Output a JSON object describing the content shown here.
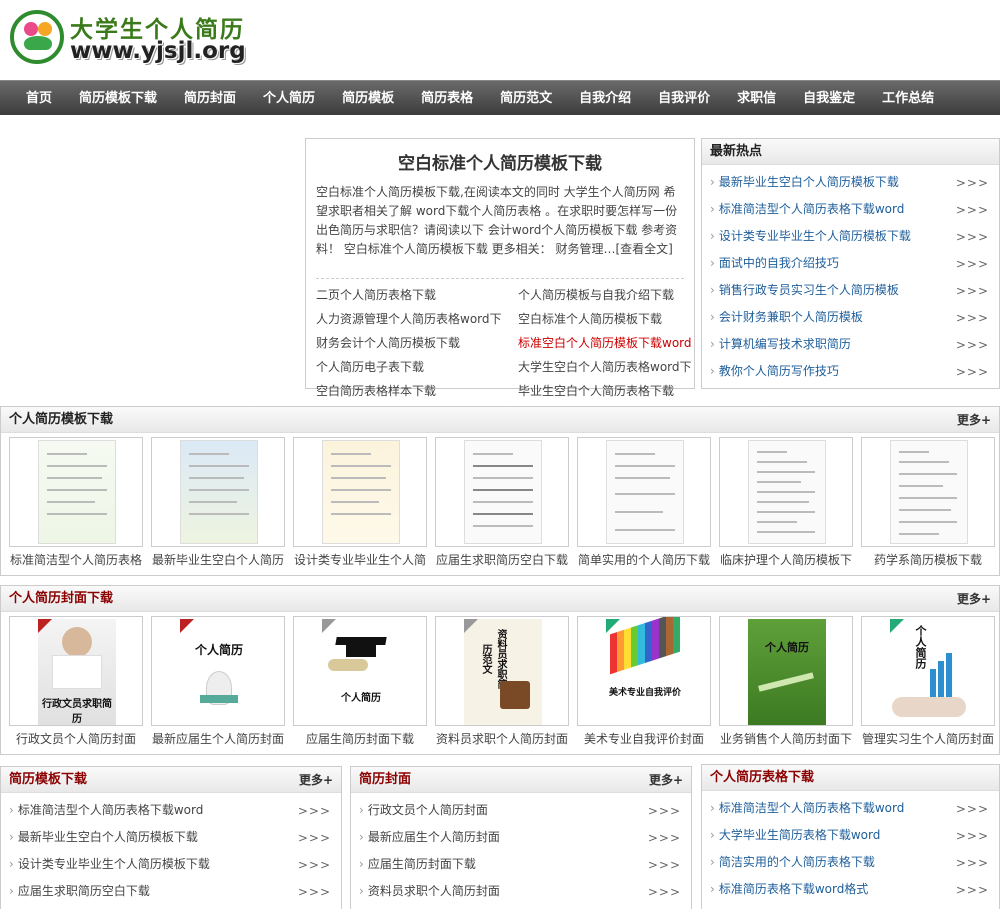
{
  "site": {
    "title": "大学生个人简历",
    "url": "www.yjsjl.org"
  },
  "nav": [
    "首页",
    "简历模板下载",
    "简历封面",
    "个人简历",
    "简历模板",
    "简历表格",
    "简历范文",
    "自我介绍",
    "自我评价",
    "求职信",
    "自我鉴定",
    "工作总结"
  ],
  "feature": {
    "title": "空白标准个人简历模板下载",
    "summary": "空白标准个人简历模板下载,在阅读本文的同时 大学生个人简历网 希望求职者相关了解 word下载个人简历表格 。在求职时要怎样写一份出色简历与求职信？请阅读以下 会计word个人简历模板下载 参考资料！ 空白标准个人简历模板下载 更多相关： 财务管理…[查看全文]",
    "links": [
      "二页个人简历表格下载",
      "个人简历模板与自我介绍下载",
      "人力资源管理个人简历表格word下",
      "空白标准个人简历模板下载",
      "财务会计个人简历模板下载",
      "标准空白个人简历模板下载word",
      "个人简历电子表下载",
      "大学生空白个人简历表格word下",
      "空白简历表格样本下载",
      "毕业生空白个人简历表格下载"
    ]
  },
  "hot": {
    "title": "最新热点",
    "arrow": ">>>",
    "items": [
      "最新毕业生空白个人简历模板下载",
      "标准简洁型个人简历表格下载word",
      "设计类专业毕业生个人简历模板下载",
      "面试中的自我介绍技巧",
      "销售行政专员实习生个人简历模板",
      "会计财务兼职个人简历模板",
      "计算机编写技术求职简历",
      "教你个人简历写作技巧"
    ]
  },
  "section_templates": {
    "title": "个人简历模板下载",
    "more": "更多+",
    "items": [
      "标准简洁型个人简历表格",
      "最新毕业生空白个人简历",
      "设计类专业毕业生个人简",
      "应届生求职简历空白下载",
      "简单实用的个人简历下载",
      "临床护理个人简历模板下",
      "药学系简历模板下载"
    ]
  },
  "section_covers": {
    "title": "个人简历封面下载",
    "more": "更多+",
    "items": [
      "行政文员个人简历封面",
      "最新应届生个人简历封面",
      "应届生简历封面下载",
      "资料员求职个人简历封面",
      "美术专业自我评价封面",
      "业务销售个人简历封面下",
      "管理实习生个人简历封面"
    ],
    "cover_texts": [
      "行政文员求职简历",
      "个人简历",
      "个人简历",
      "资料员求职简历范文",
      "美术专业自我评价",
      "个人简历",
      "个人简历"
    ]
  },
  "box_templates": {
    "title": "简历模板下载",
    "more": "更多+",
    "arrow": ">>>",
    "items": [
      "标准简洁型个人简历表格下载word",
      "最新毕业生空白个人简历模板下载",
      "设计类专业毕业生个人简历模板下载",
      "应届生求职简历空白下载"
    ]
  },
  "box_covers": {
    "title": "简历封面",
    "more": "更多+",
    "arrow": ">>>",
    "items": [
      "行政文员个人简历封面",
      "最新应届生个人简历封面",
      "应届生简历封面下载",
      "资料员求职个人简历封面"
    ]
  },
  "box_tables": {
    "title": "个人简历表格下载",
    "arrow": ">>>",
    "items": [
      "标准简洁型个人简历表格下载word",
      "大学毕业生简历表格下载word",
      "简洁实用的个人简历表格下载",
      "标准简历表格下载word格式"
    ]
  },
  "colors": {
    "nav_bg": "#4a4a4a",
    "link_blue": "#1e5e9a",
    "hot_red": "#cc0000",
    "section_title_red": "#8b0000"
  }
}
